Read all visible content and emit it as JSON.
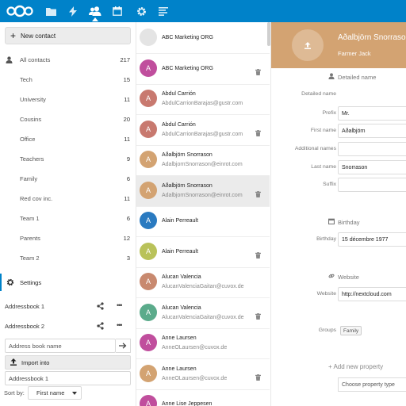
{
  "topbar": {
    "icons": [
      "nextcloud-logo",
      "folder-icon",
      "activity-icon",
      "contacts-icon",
      "calendar-icon",
      "gear-icon",
      "notes-icon"
    ],
    "color": "#0082c9"
  },
  "sidebar": {
    "new_contact": "New contact",
    "groups": [
      {
        "label": "All contacts",
        "count": "217"
      },
      {
        "label": "Tech",
        "count": "15"
      },
      {
        "label": "University",
        "count": "11"
      },
      {
        "label": "Cousins",
        "count": "20"
      },
      {
        "label": "Office",
        "count": "11"
      },
      {
        "label": "Teachers",
        "count": "9"
      },
      {
        "label": "Family",
        "count": "6"
      },
      {
        "label": "Red cov inc.",
        "count": "11"
      },
      {
        "label": "Team 1",
        "count": "6"
      },
      {
        "label": "Parents",
        "count": "12"
      },
      {
        "label": "Team 2",
        "count": "3"
      }
    ],
    "settings_label": "Settings",
    "addressbooks": [
      {
        "label": "Addressbook 1"
      },
      {
        "label": "Addressbook 2"
      }
    ],
    "addressbook_name_placeholder": "Address book name",
    "import_label": "Import into",
    "import_target": "Addressbook 1",
    "sort_label": "Sort by:",
    "sort_value": "First name"
  },
  "contacts": [
    {
      "initial": "A",
      "color": "#e4e4e4",
      "name": "ABC Marketing ORG",
      "email": "",
      "selected": false,
      "trash": false,
      "blank": true
    },
    {
      "initial": "A",
      "color": "#c04e9d",
      "name": "ABC Marketing ORG",
      "email": "",
      "selected": false,
      "trash": true
    },
    {
      "initial": "A",
      "color": "#c8796f",
      "name": "Abdul Carrión",
      "email": "AbdulCarrionBarajas@gustr.com",
      "selected": false,
      "trash": false
    },
    {
      "initial": "A",
      "color": "#c8796f",
      "name": "Abdul Carrión",
      "email": "AbdulCarrionBarajas@gustr.com",
      "selected": false,
      "trash": true
    },
    {
      "initial": "A",
      "color": "#d3a372",
      "name": "Aðalbjörn Snorrason",
      "email": "AdalbjornSnorrason@einrot.com",
      "selected": false,
      "trash": false
    },
    {
      "initial": "A",
      "color": "#d3a372",
      "name": "Aðalbjörn Snorrason",
      "email": "AdalbjornSnorrason@einrot.com",
      "selected": true,
      "trash": true
    },
    {
      "initial": "A",
      "color": "#2a7ac0",
      "name": "Alain Perreault",
      "email": "",
      "selected": false,
      "trash": false
    },
    {
      "initial": "A",
      "color": "#b9c25a",
      "name": "Alain Perreault",
      "email": "",
      "selected": false,
      "trash": true
    },
    {
      "initial": "A",
      "color": "#c8896f",
      "name": "Alucan Valencia",
      "email": "AlucanValenciaGaitan@cuvox.de",
      "selected": false,
      "trash": false
    },
    {
      "initial": "A",
      "color": "#5bab8b",
      "name": "Alucan Valencia",
      "email": "AlucanValenciaGaitan@cuvox.de",
      "selected": false,
      "trash": true
    },
    {
      "initial": "A",
      "color": "#c04e9d",
      "name": "Anne Laursen",
      "email": "AnneOLaursen@cuvox.de",
      "selected": false,
      "trash": false
    },
    {
      "initial": "A",
      "color": "#d3a372",
      "name": "Anne Laursen",
      "email": "AnneOLaursen@cuvox.de",
      "selected": false,
      "trash": true
    },
    {
      "initial": "A",
      "color": "#c04e9d",
      "name": "Anne Lise Jeppesen",
      "email": "",
      "selected": false,
      "trash": false
    }
  ],
  "detail": {
    "header_color": "#d3a372",
    "name": "Aðalbjörn Snorrason",
    "org": "Farmer Jack",
    "detailed_name_title": "Detailed name",
    "fields": {
      "detailed_name_label": "Detailed name",
      "prefix_label": "Prefix",
      "prefix_value": "Mr.",
      "first_name_label": "First name",
      "first_name_value": "Aðalbjörn",
      "additional_names_label": "Additional names",
      "additional_names_value": "",
      "last_name_label": "Last name",
      "last_name_value": "Snorrason",
      "suffix_label": "Suffix",
      "suffix_value": ""
    },
    "birthday_title": "Birthday",
    "birthday_label": "Birthday",
    "birthday_value": "15 décembre 1977",
    "website_title": "Website",
    "website_label": "Website",
    "website_value": "http://nextcloud.com",
    "groups_label": "Groups",
    "groups_chip": "Family",
    "add_property": "+ Add new property",
    "property_placeholder": "Choose property type"
  }
}
